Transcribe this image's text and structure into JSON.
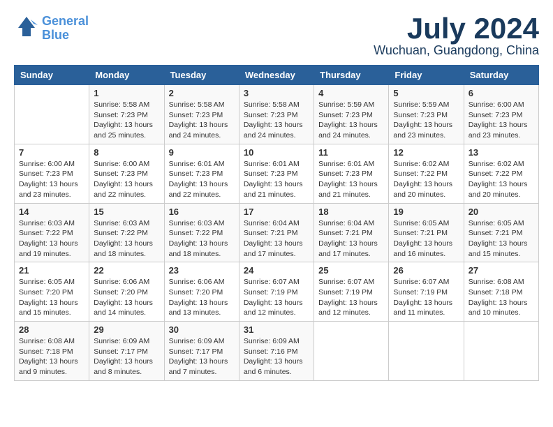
{
  "header": {
    "logo_line1": "General",
    "logo_line2": "Blue",
    "month": "July 2024",
    "location": "Wuchuan, Guangdong, China"
  },
  "weekdays": [
    "Sunday",
    "Monday",
    "Tuesday",
    "Wednesday",
    "Thursday",
    "Friday",
    "Saturday"
  ],
  "weeks": [
    [
      {
        "day": "",
        "info": ""
      },
      {
        "day": "1",
        "info": "Sunrise: 5:58 AM\nSunset: 7:23 PM\nDaylight: 13 hours\nand 25 minutes."
      },
      {
        "day": "2",
        "info": "Sunrise: 5:58 AM\nSunset: 7:23 PM\nDaylight: 13 hours\nand 24 minutes."
      },
      {
        "day": "3",
        "info": "Sunrise: 5:58 AM\nSunset: 7:23 PM\nDaylight: 13 hours\nand 24 minutes."
      },
      {
        "day": "4",
        "info": "Sunrise: 5:59 AM\nSunset: 7:23 PM\nDaylight: 13 hours\nand 24 minutes."
      },
      {
        "day": "5",
        "info": "Sunrise: 5:59 AM\nSunset: 7:23 PM\nDaylight: 13 hours\nand 23 minutes."
      },
      {
        "day": "6",
        "info": "Sunrise: 6:00 AM\nSunset: 7:23 PM\nDaylight: 13 hours\nand 23 minutes."
      }
    ],
    [
      {
        "day": "7",
        "info": "Sunrise: 6:00 AM\nSunset: 7:23 PM\nDaylight: 13 hours\nand 23 minutes."
      },
      {
        "day": "8",
        "info": "Sunrise: 6:00 AM\nSunset: 7:23 PM\nDaylight: 13 hours\nand 22 minutes."
      },
      {
        "day": "9",
        "info": "Sunrise: 6:01 AM\nSunset: 7:23 PM\nDaylight: 13 hours\nand 22 minutes."
      },
      {
        "day": "10",
        "info": "Sunrise: 6:01 AM\nSunset: 7:23 PM\nDaylight: 13 hours\nand 21 minutes."
      },
      {
        "day": "11",
        "info": "Sunrise: 6:01 AM\nSunset: 7:23 PM\nDaylight: 13 hours\nand 21 minutes."
      },
      {
        "day": "12",
        "info": "Sunrise: 6:02 AM\nSunset: 7:22 PM\nDaylight: 13 hours\nand 20 minutes."
      },
      {
        "day": "13",
        "info": "Sunrise: 6:02 AM\nSunset: 7:22 PM\nDaylight: 13 hours\nand 20 minutes."
      }
    ],
    [
      {
        "day": "14",
        "info": "Sunrise: 6:03 AM\nSunset: 7:22 PM\nDaylight: 13 hours\nand 19 minutes."
      },
      {
        "day": "15",
        "info": "Sunrise: 6:03 AM\nSunset: 7:22 PM\nDaylight: 13 hours\nand 18 minutes."
      },
      {
        "day": "16",
        "info": "Sunrise: 6:03 AM\nSunset: 7:22 PM\nDaylight: 13 hours\nand 18 minutes."
      },
      {
        "day": "17",
        "info": "Sunrise: 6:04 AM\nSunset: 7:21 PM\nDaylight: 13 hours\nand 17 minutes."
      },
      {
        "day": "18",
        "info": "Sunrise: 6:04 AM\nSunset: 7:21 PM\nDaylight: 13 hours\nand 17 minutes."
      },
      {
        "day": "19",
        "info": "Sunrise: 6:05 AM\nSunset: 7:21 PM\nDaylight: 13 hours\nand 16 minutes."
      },
      {
        "day": "20",
        "info": "Sunrise: 6:05 AM\nSunset: 7:21 PM\nDaylight: 13 hours\nand 15 minutes."
      }
    ],
    [
      {
        "day": "21",
        "info": "Sunrise: 6:05 AM\nSunset: 7:20 PM\nDaylight: 13 hours\nand 15 minutes."
      },
      {
        "day": "22",
        "info": "Sunrise: 6:06 AM\nSunset: 7:20 PM\nDaylight: 13 hours\nand 14 minutes."
      },
      {
        "day": "23",
        "info": "Sunrise: 6:06 AM\nSunset: 7:20 PM\nDaylight: 13 hours\nand 13 minutes."
      },
      {
        "day": "24",
        "info": "Sunrise: 6:07 AM\nSunset: 7:19 PM\nDaylight: 13 hours\nand 12 minutes."
      },
      {
        "day": "25",
        "info": "Sunrise: 6:07 AM\nSunset: 7:19 PM\nDaylight: 13 hours\nand 12 minutes."
      },
      {
        "day": "26",
        "info": "Sunrise: 6:07 AM\nSunset: 7:19 PM\nDaylight: 13 hours\nand 11 minutes."
      },
      {
        "day": "27",
        "info": "Sunrise: 6:08 AM\nSunset: 7:18 PM\nDaylight: 13 hours\nand 10 minutes."
      }
    ],
    [
      {
        "day": "28",
        "info": "Sunrise: 6:08 AM\nSunset: 7:18 PM\nDaylight: 13 hours\nand 9 minutes."
      },
      {
        "day": "29",
        "info": "Sunrise: 6:09 AM\nSunset: 7:17 PM\nDaylight: 13 hours\nand 8 minutes."
      },
      {
        "day": "30",
        "info": "Sunrise: 6:09 AM\nSunset: 7:17 PM\nDaylight: 13 hours\nand 7 minutes."
      },
      {
        "day": "31",
        "info": "Sunrise: 6:09 AM\nSunset: 7:16 PM\nDaylight: 13 hours\nand 6 minutes."
      },
      {
        "day": "",
        "info": ""
      },
      {
        "day": "",
        "info": ""
      },
      {
        "day": "",
        "info": ""
      }
    ]
  ]
}
